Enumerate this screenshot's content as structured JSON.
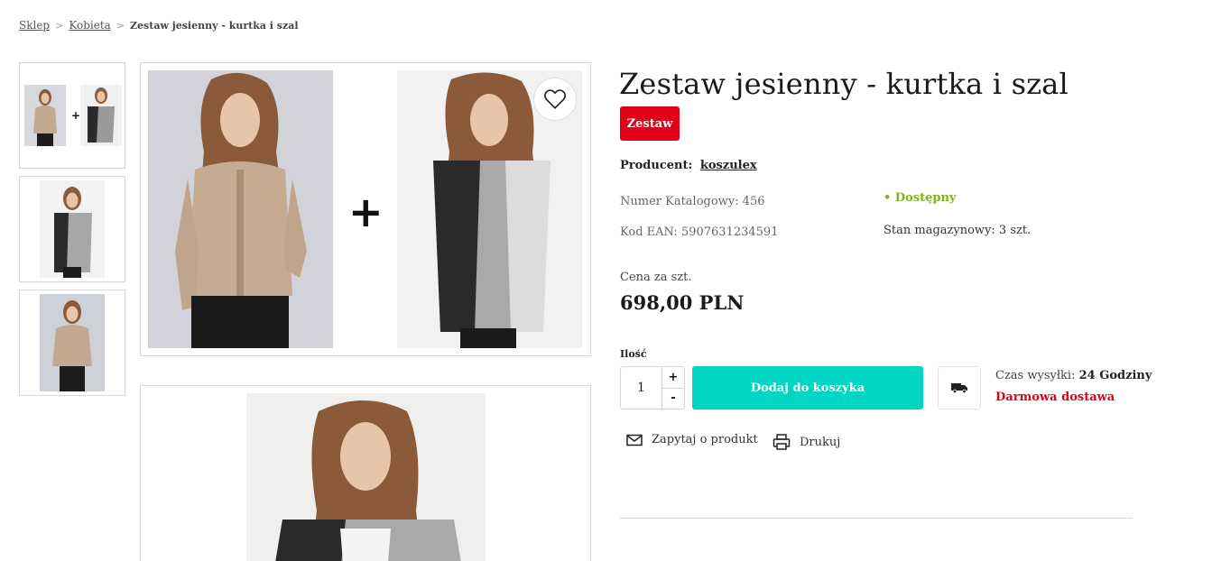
{
  "breadcrumb": {
    "items": [
      "Sklep",
      "Kobieta"
    ],
    "current": "Zestaw jesienny - kurtka i szal",
    "separator": ">"
  },
  "gallery": {
    "plus": "+",
    "favorite_icon": "heart-icon"
  },
  "product": {
    "title": "Zestaw jesienny - kurtka i szal",
    "badge": "Zestaw",
    "producer_label": "Producent:",
    "producer_name": "koszulex",
    "catalog_number": "Numer Katalogowy: 456",
    "ean": "Kod EAN: 5907631234591",
    "availability": "• Dostępny",
    "stock": "Stan magazynowy: 3 szt.",
    "price_label": "Cena za szt.",
    "price": "698,00 PLN"
  },
  "cart": {
    "qty_label": "Ilość",
    "qty_value": "1",
    "plus": "+",
    "minus": "-",
    "add_button": "Dodaj do koszyka"
  },
  "shipping": {
    "time_label": "Czas wysyłki:",
    "time_value": "24 Godziny",
    "free": "Darmowa dostawa",
    "icon": "truck-icon"
  },
  "actions": {
    "ask": "Zapytaj o produkt",
    "print": "Drukuj"
  },
  "colors": {
    "badge": "#e3001b",
    "add_button": "#00d6c2",
    "available": "#7cb518",
    "free_shipping": "#e3001b"
  }
}
